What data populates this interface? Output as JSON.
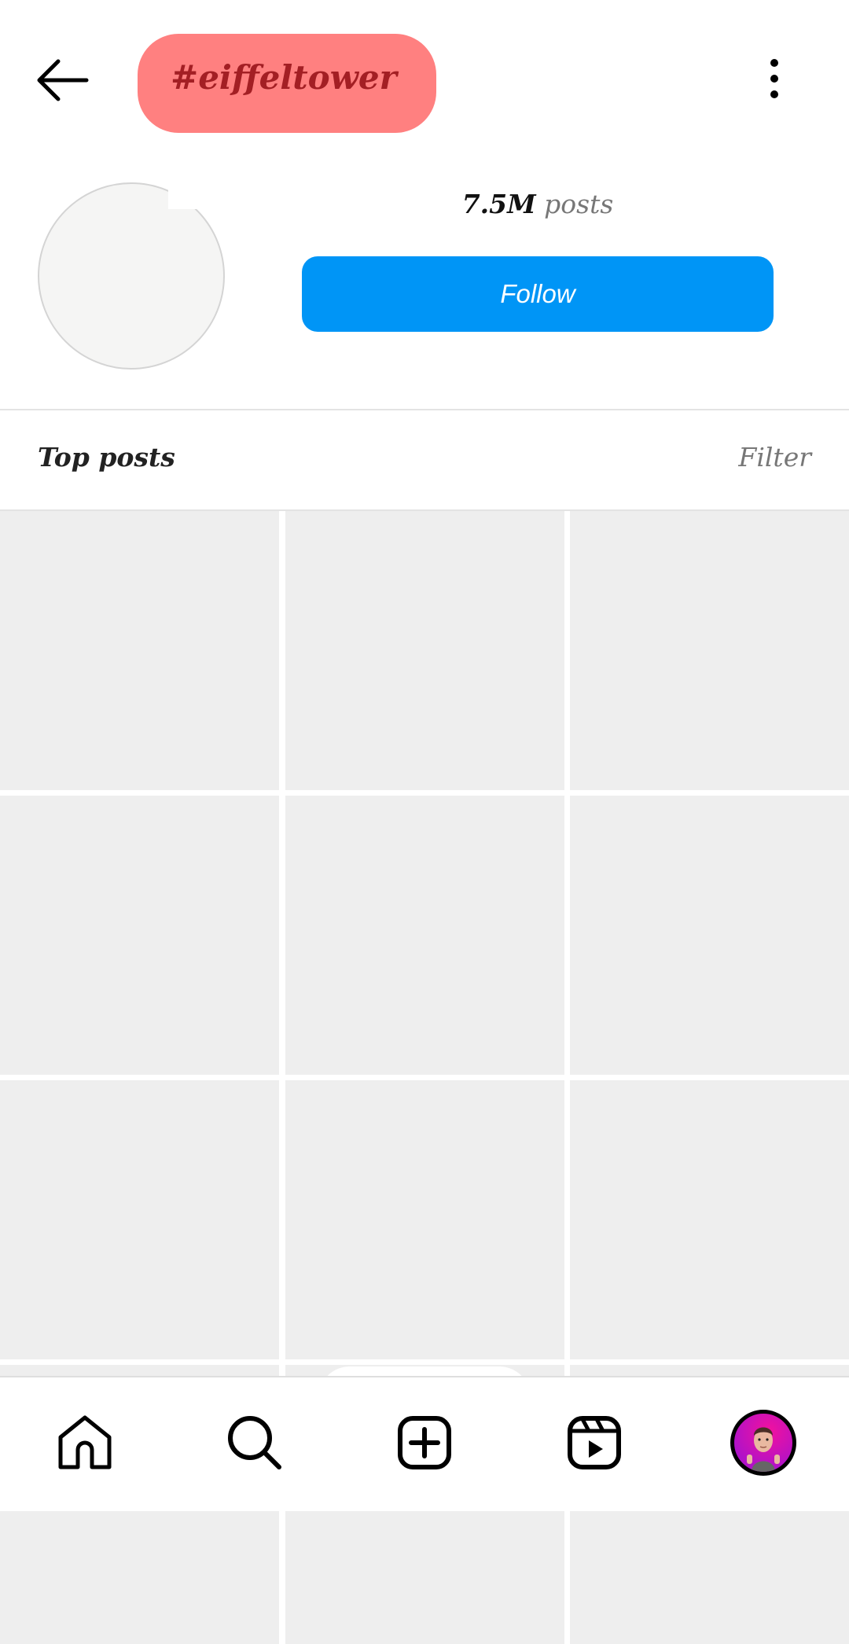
{
  "header": {
    "back_icon": "arrow-left-icon",
    "title": "#eiffeltower",
    "title_pill_color": "#FF8080",
    "title_text_color": "#A31F24",
    "more_icon": "vertical-ellipsis-icon"
  },
  "profile": {
    "avatar": "hashtag-avatar-placeholder",
    "posts_count": "7.5M",
    "posts_label": "posts",
    "follow_label": "Follow",
    "follow_color": "#0095F6"
  },
  "section": {
    "title": "Top posts",
    "filter_label": "Filter"
  },
  "grid": {
    "tile_color": "#EEEEEE",
    "tiles_visible": 12
  },
  "bottom_nav": {
    "items": [
      {
        "name": "home",
        "icon": "home-icon"
      },
      {
        "name": "search",
        "icon": "search-icon"
      },
      {
        "name": "create",
        "icon": "plus-square-icon"
      },
      {
        "name": "reels",
        "icon": "reels-icon"
      },
      {
        "name": "profile",
        "icon": "profile-avatar"
      }
    ]
  }
}
